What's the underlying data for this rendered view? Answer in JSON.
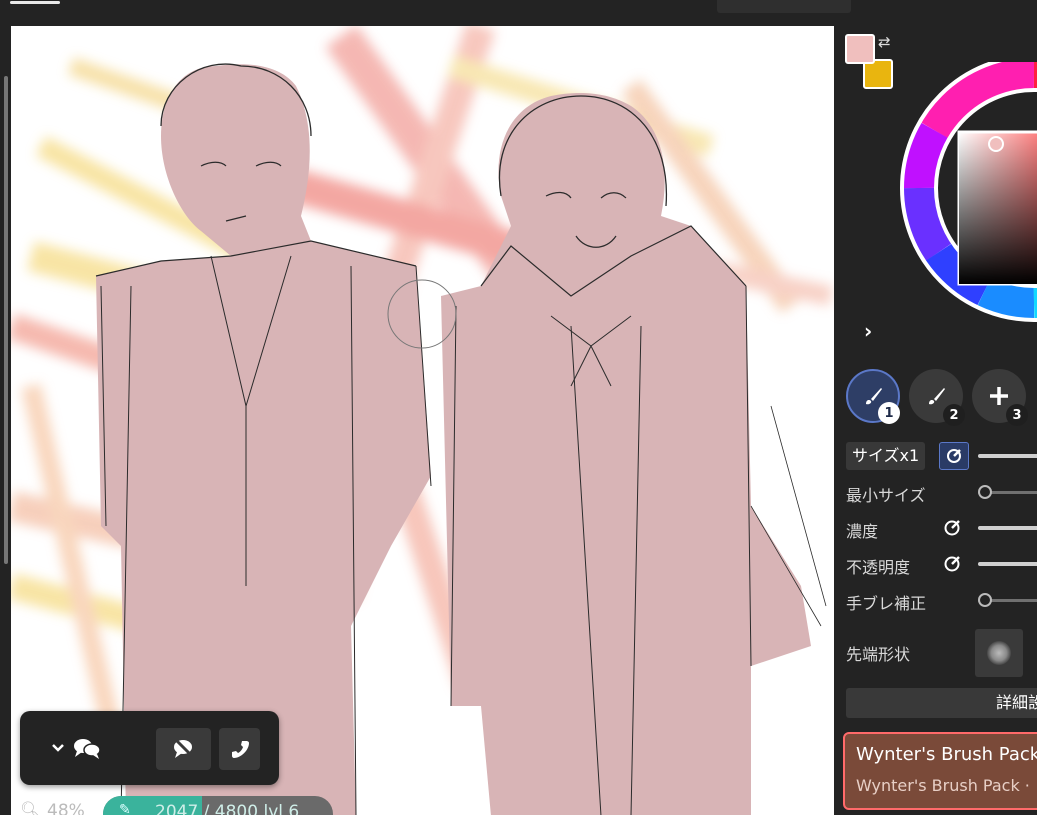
{
  "canvas": {
    "colors": {
      "skin": "#d8b4b6",
      "line": "#2b2b2b",
      "bg_red": "#f08a83",
      "bg_yellow": "#f6dc86"
    }
  },
  "panel": {
    "colors": {
      "foreground": "#f0bfbe",
      "background": "#e9b50f"
    },
    "brush_slots": [
      {
        "number": "1",
        "icon": "brush-icon"
      },
      {
        "number": "2",
        "icon": "brush-icon"
      },
      {
        "number": "3",
        "icon": "plus-icon"
      }
    ],
    "size_label": "サイズx1",
    "params": [
      {
        "label": "最小サイズ",
        "value": 0
      },
      {
        "label": "濃度"
      },
      {
        "label": "不透明度"
      },
      {
        "label": "手ブレ補正",
        "value": 0
      }
    ],
    "tip_label": "先端形状",
    "detail_label": "詳細設",
    "brushpack": {
      "title": "Wynter's Brush Pack",
      "subtitle": "Wynter's Brush Pack ·"
    }
  },
  "status": {
    "zoom": "48%",
    "progress_text": "2047 / 4800 lvl 6",
    "progress_fraction": 0.43
  },
  "colors": {
    "accent": "#3ab39c",
    "panel_bg": "#232323",
    "brush_active": "#2e3e66",
    "brushpack_border": "#ff6a6a"
  }
}
